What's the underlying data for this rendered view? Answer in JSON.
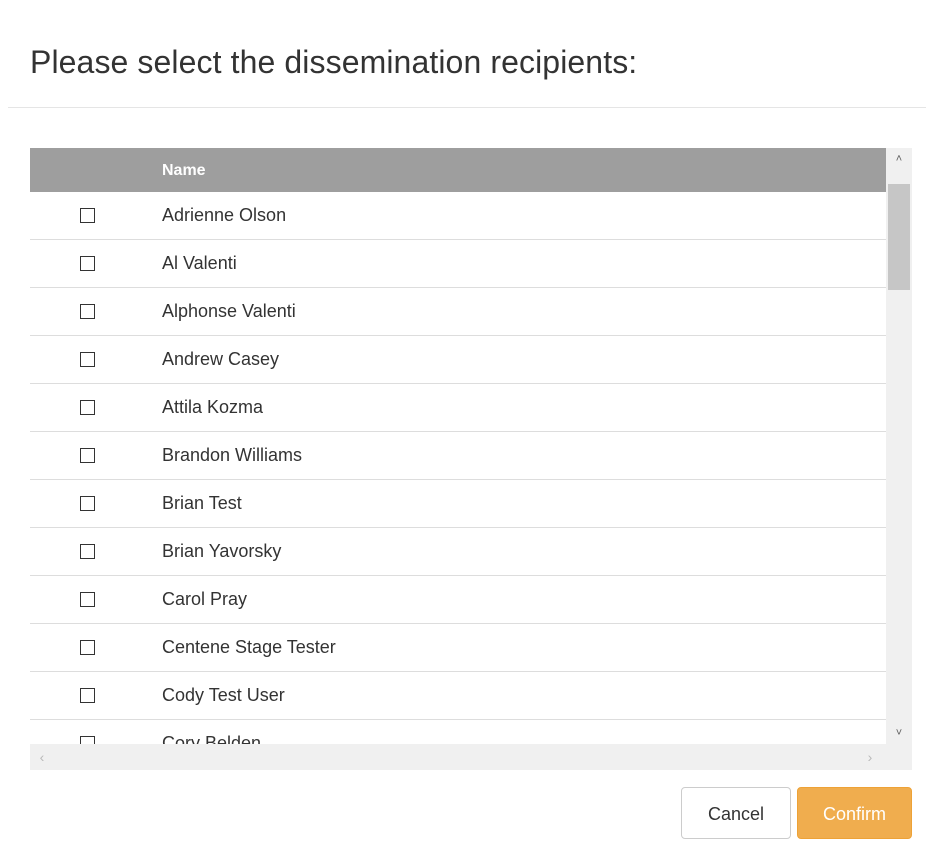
{
  "dialog": {
    "title": "Please select the dissemination recipients:"
  },
  "grid": {
    "columns": {
      "select": "",
      "name": "Name"
    },
    "rows": [
      {
        "name": "Adrienne Olson",
        "checked": false
      },
      {
        "name": "Al Valenti",
        "checked": false
      },
      {
        "name": "Alphonse Valenti",
        "checked": false
      },
      {
        "name": "Andrew Casey",
        "checked": false
      },
      {
        "name": "Attila Kozma",
        "checked": false
      },
      {
        "name": "Brandon Williams",
        "checked": false
      },
      {
        "name": "Brian Test",
        "checked": false
      },
      {
        "name": "Brian Yavorsky",
        "checked": false
      },
      {
        "name": "Carol Pray",
        "checked": false
      },
      {
        "name": "Centene Stage Tester",
        "checked": false
      },
      {
        "name": "Cody Test User",
        "checked": false
      },
      {
        "name": "Cory Belden",
        "checked": false
      }
    ],
    "scrollbar": {
      "up_arrow": "˄",
      "down_arrow": "˅",
      "left_arrow": "‹",
      "right_arrow": "›"
    }
  },
  "footer": {
    "cancel_label": "Cancel",
    "confirm_label": "Confirm"
  },
  "colors": {
    "header_bg": "#9e9e9e",
    "confirm_bg": "#f0ad4e",
    "row_border": "#dddddd"
  }
}
